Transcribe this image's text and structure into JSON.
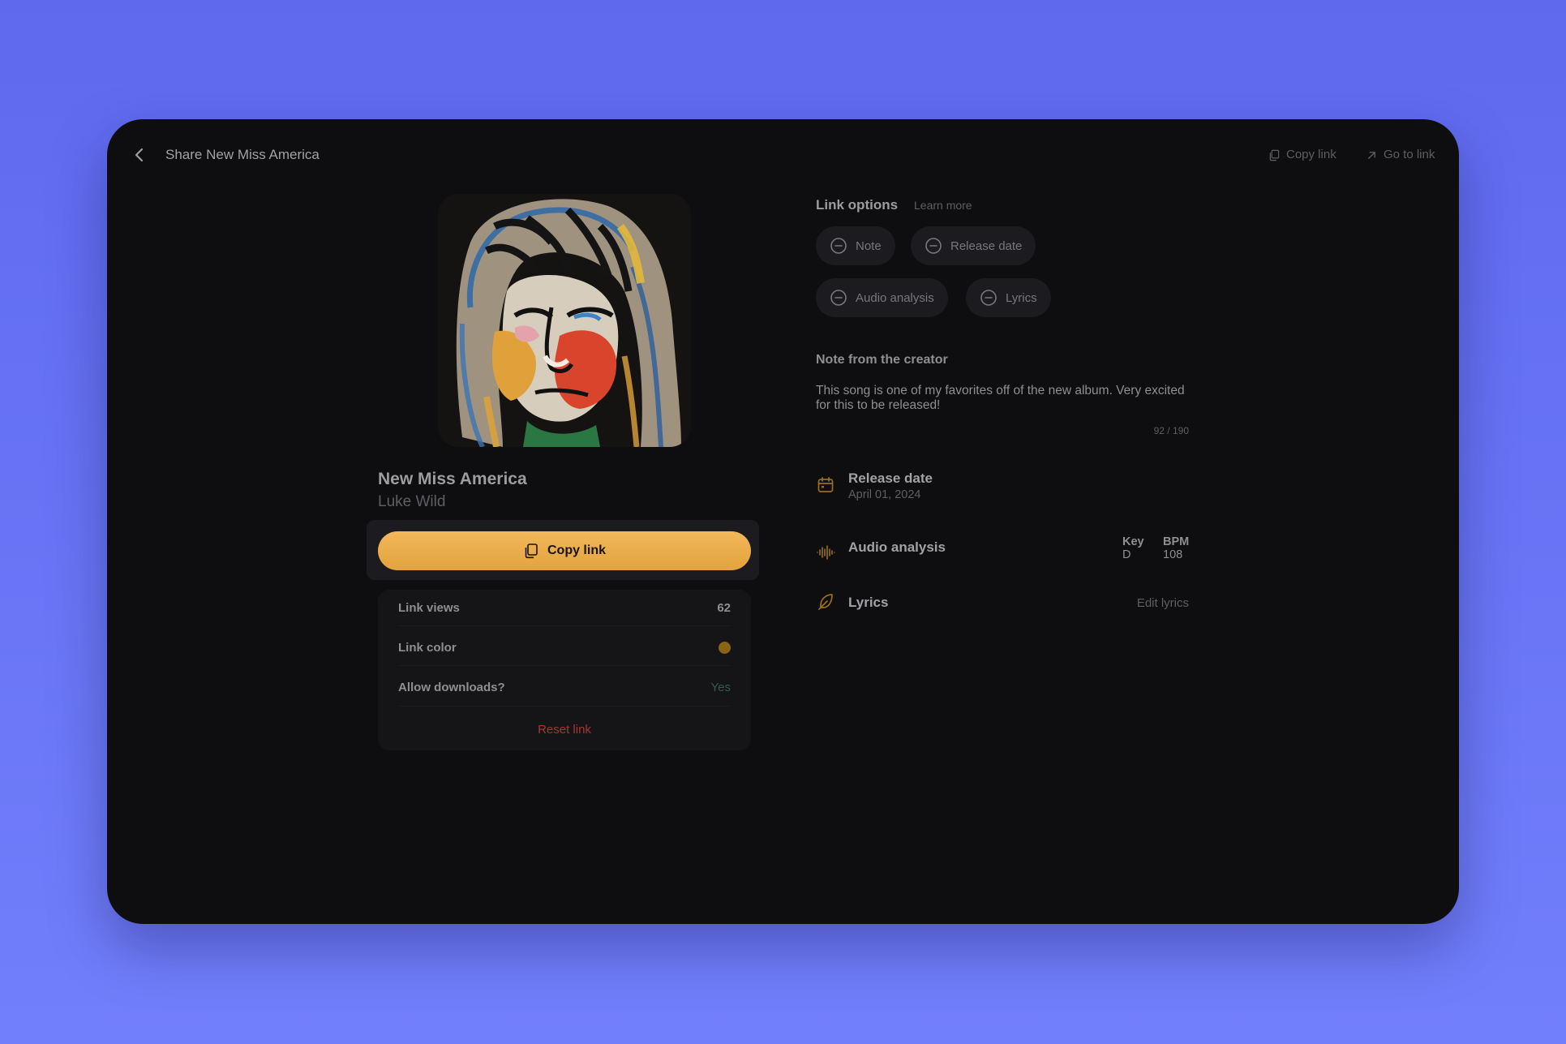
{
  "header": {
    "title": "Share New Miss America",
    "actions": {
      "copy_link": "Copy link",
      "go_to_link": "Go to link"
    }
  },
  "song": {
    "title": "New Miss America",
    "artist": "Luke Wild",
    "copy_button": "Copy link"
  },
  "stats": {
    "link_views_label": "Link views",
    "link_views_value": "62",
    "link_color_label": "Link color",
    "link_color_value": "#8a6416",
    "allow_downloads_label": "Allow downloads?",
    "allow_downloads_value": "Yes",
    "reset_link": "Reset link"
  },
  "link_options": {
    "title": "Link options",
    "learn_more": "Learn more",
    "pills": [
      "Note",
      "Release date",
      "Audio analysis",
      "Lyrics"
    ]
  },
  "note": {
    "title": "Note from the creator",
    "text": "This song is one of my favorites off of the new album. Very excited for this to be released!",
    "counter": "92 / 190"
  },
  "release": {
    "title": "Release date",
    "date": "April 01, 2024"
  },
  "audio": {
    "title": "Audio analysis",
    "key_label": "Key",
    "key_value": "D",
    "bpm_label": "BPM",
    "bpm_value": "108"
  },
  "lyrics": {
    "title": "Lyrics",
    "edit": "Edit lyrics"
  },
  "colors": {
    "accent": "#e9ab47",
    "background_gradient_top": "#5f69ee",
    "window": "#0e0e11",
    "danger": "#a5382e",
    "success": "#2f5d48"
  }
}
